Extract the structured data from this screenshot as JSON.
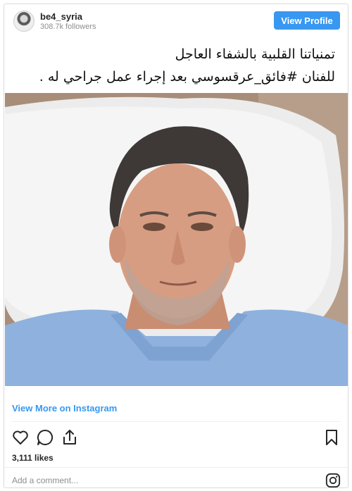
{
  "header": {
    "username": "be4_syria",
    "followers": "308.7k followers",
    "view_profile_label": "View Profile"
  },
  "caption": {
    "line1": "تمنياتنا القلبية بالشفاء العاجل",
    "line2": "للفنان #فائق_عرقسوسي  بعد إجراء عمل جراحي له ."
  },
  "footer": {
    "view_more_label": "View More on Instagram",
    "likes": "3,111 likes",
    "comment_placeholder": "Add a comment..."
  },
  "icons": {
    "like": "heart-icon",
    "comment": "comment-icon",
    "share": "share-icon",
    "save": "bookmark-icon",
    "brand": "instagram-icon"
  },
  "colors": {
    "accent": "#3897f0",
    "text": "#262626",
    "muted": "#8e8e8e",
    "border": "#dbdbdb"
  }
}
